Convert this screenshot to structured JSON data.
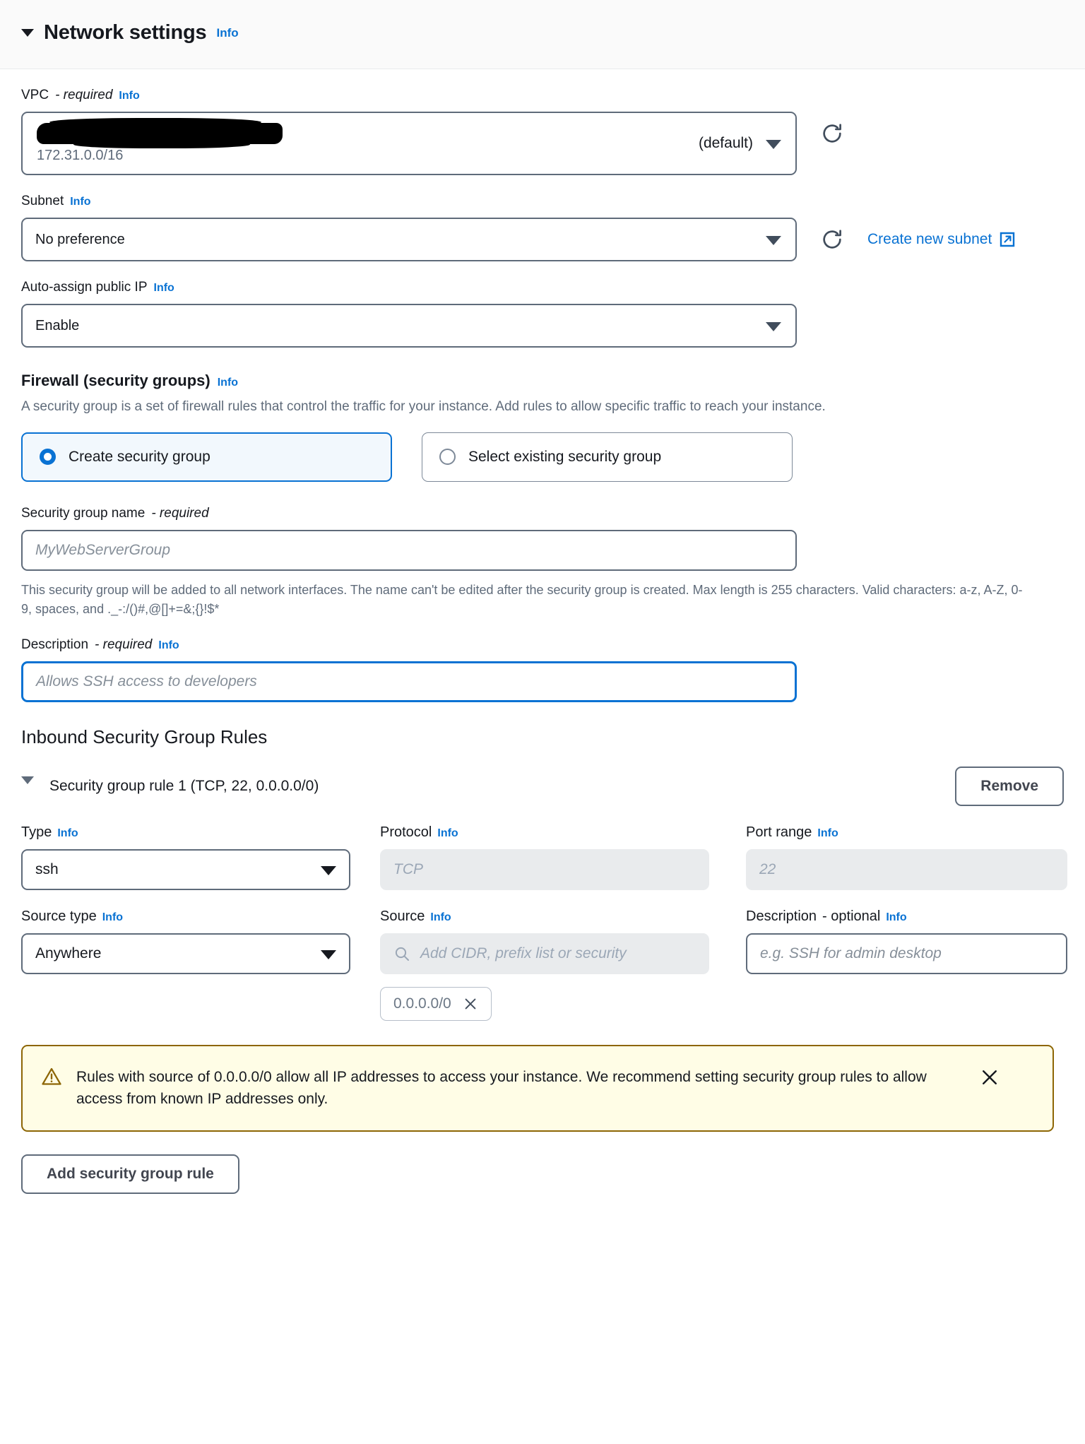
{
  "header": {
    "title": "Network settings",
    "info_label": "Info"
  },
  "vpc": {
    "label": "VPC",
    "required_suffix": "- required",
    "info_label": "Info",
    "selected_id_redacted": "",
    "cidr": "172.31.0.0/16",
    "default_badge": "(default)"
  },
  "subnet": {
    "label": "Subnet",
    "info_label": "Info",
    "value": "No preference",
    "create_link": "Create new subnet"
  },
  "auto_assign_ip": {
    "label": "Auto-assign public IP",
    "info_label": "Info",
    "value": "Enable"
  },
  "firewall": {
    "title": "Firewall (security groups)",
    "info_label": "Info",
    "description": "A security group is a set of firewall rules that control the traffic for your instance. Add rules to allow specific traffic to reach your instance.",
    "options": [
      {
        "label": "Create security group",
        "selected": true
      },
      {
        "label": "Select existing security group",
        "selected": false
      }
    ]
  },
  "sg_name": {
    "label": "Security group name",
    "required_suffix": "- required",
    "placeholder": "MyWebServerGroup",
    "value": "",
    "help": "This security group will be added to all network interfaces. The name can't be edited after the security group is created. Max length is 255 characters. Valid characters: a-z, A-Z, 0-9, spaces, and ._-:/()#,@[]+=&;{}!$*"
  },
  "sg_description": {
    "label": "Description",
    "required_suffix": "- required",
    "info_label": "Info",
    "placeholder": "Allows SSH access to developers",
    "value": ""
  },
  "inbound": {
    "heading": "Inbound Security Group Rules",
    "rule_summary": "Security group rule 1 (TCP, 22, 0.0.0.0/0)",
    "remove_label": "Remove",
    "fields": {
      "type_label": "Type",
      "type_value": "ssh",
      "protocol_label": "Protocol",
      "protocol_value": "TCP",
      "port_label": "Port range",
      "port_value": "22",
      "source_type_label": "Source type",
      "source_type_value": "Anywhere",
      "source_label": "Source",
      "source_placeholder": "Add CIDR, prefix list or security",
      "source_token": "0.0.0.0/0",
      "description_label": "Description",
      "description_optional": "- optional",
      "description_placeholder": "e.g. SSH for admin desktop",
      "info_label": "Info"
    }
  },
  "warning": {
    "text": "Rules with source of 0.0.0.0/0 allow all IP addresses to access your instance. We recommend setting security group rules to allow access from known IP addresses only."
  },
  "add_rule": {
    "label": "Add security group rule"
  },
  "colors": {
    "link": "#0972d3",
    "border": "#5f6b7a",
    "warning_border": "#8d6605",
    "warning_bg": "#fffde6",
    "selected_bg": "#f2f8fd"
  }
}
